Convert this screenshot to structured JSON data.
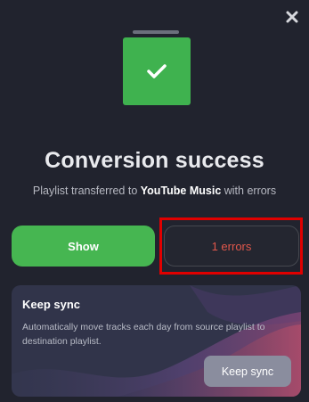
{
  "dialog": {
    "title": "Conversion success",
    "subtitle": {
      "prefix": "Playlist transferred to ",
      "destination": "YouTube Music",
      "suffix": " with errors"
    }
  },
  "actions": {
    "show_label": "Show",
    "errors_label": "1 errors"
  },
  "sync_card": {
    "title": "Keep sync",
    "description": "Automatically move tracks each day from source playlist to destination playlist.",
    "button_label": "Keep sync"
  },
  "colors": {
    "background": "#21232e",
    "success": "#3fb24f",
    "error_text": "#e0574b",
    "highlight": "#e00000",
    "card": "#31344a"
  },
  "icons": {
    "close": "close-icon",
    "success": "checkmark-icon"
  }
}
